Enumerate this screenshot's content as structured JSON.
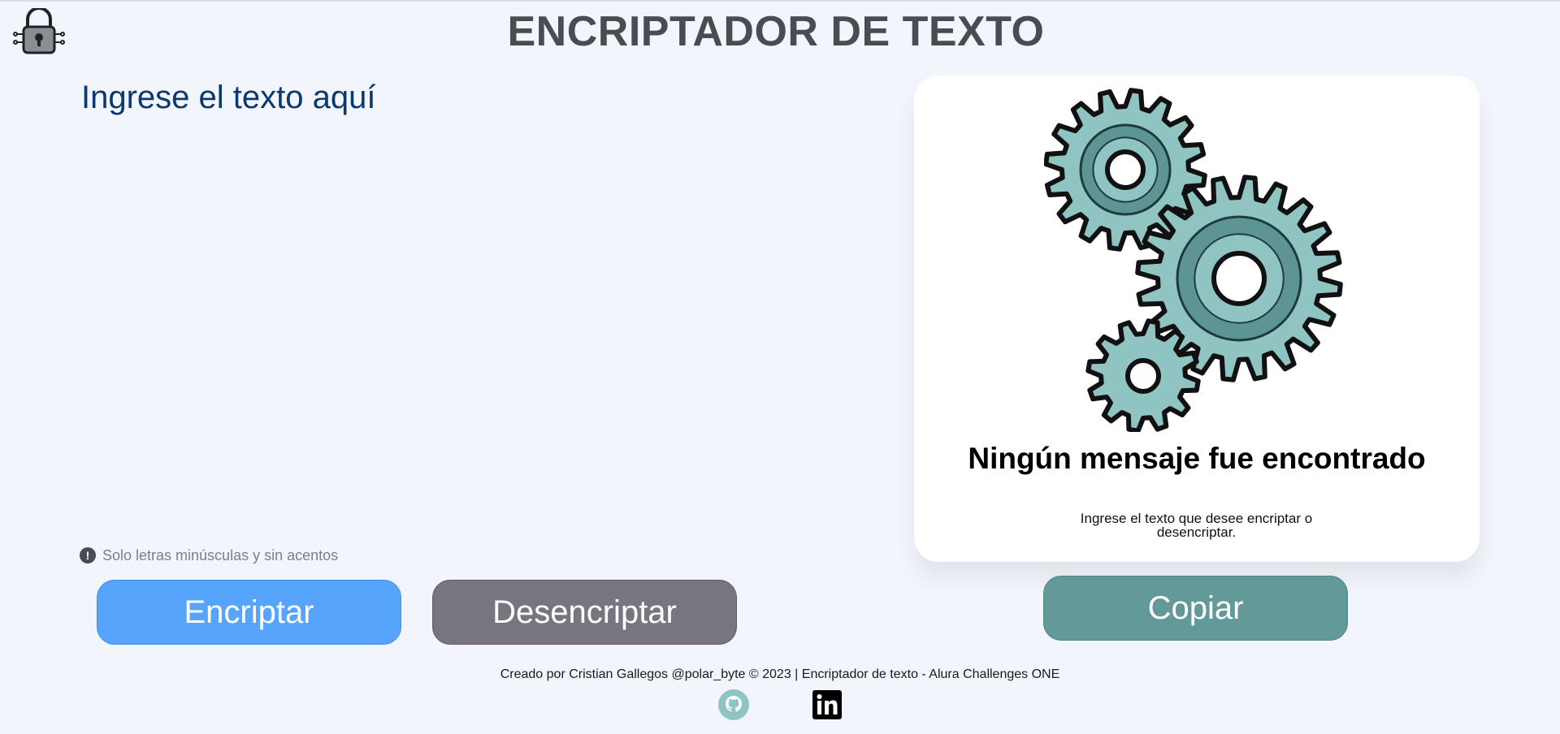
{
  "header": {
    "title": "ENCRIPTADOR DE TEXTO",
    "logo_icon": "padlock-circuit-icon"
  },
  "input": {
    "placeholder": "Ingrese el texto aquí",
    "value": ""
  },
  "hint": {
    "icon": "exclamation-circle-icon",
    "text": "Solo letras minúsculas y sin acentos"
  },
  "buttons": {
    "encrypt": "Encriptar",
    "decrypt": "Desencriptar",
    "copy": "Copiar"
  },
  "output": {
    "illustration_icon": "gears-icon",
    "title": "Ningún mensaje fue encontrado",
    "subtitle": "Ingrese el texto que desee encriptar o desencriptar."
  },
  "footer": {
    "text": "Creado por Cristian Gallegos @polar_byte © 2023 | Encriptador de texto - Alura Challenges ONE",
    "links": [
      {
        "icon": "github-icon"
      },
      {
        "icon": "linkedin-icon"
      }
    ]
  },
  "colors": {
    "background": "#f2f5fc",
    "primary_text": "#0a3871",
    "encrypt_button": "#56a4fb",
    "decrypt_button": "#787580",
    "copy_button": "#64999a",
    "gear_fill": "#8fc4c2"
  }
}
